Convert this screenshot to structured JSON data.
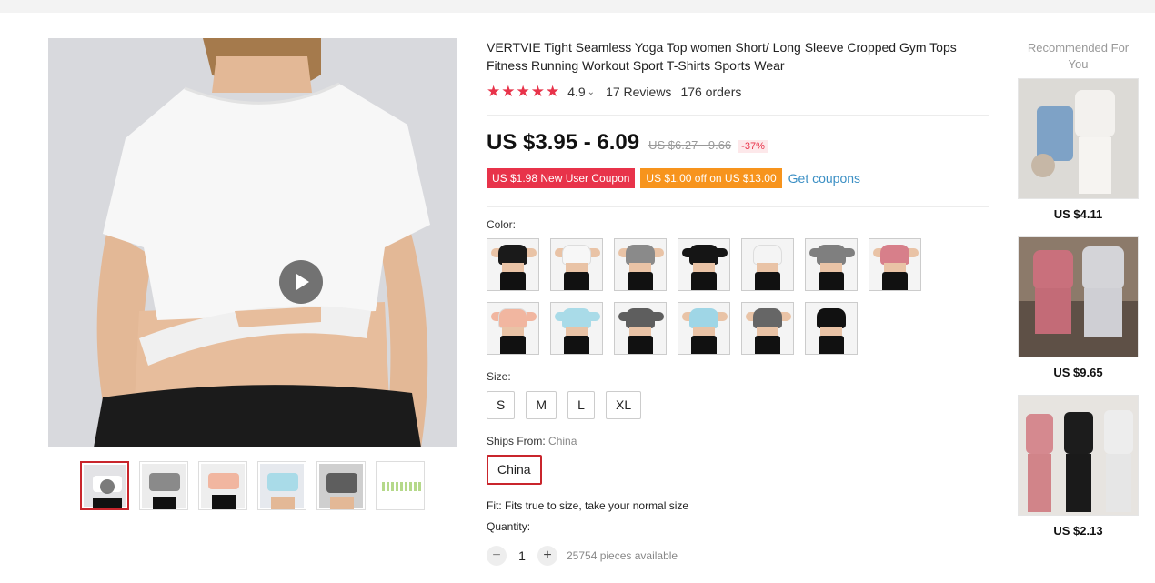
{
  "product": {
    "title": "VERTVIE Tight Seamless Yoga Top women Short/ Long Sleeve Cropped Gym Tops Fitness Running Workout Sport T-Shirts Sports Wear",
    "stars": "★★★★★",
    "rating": "4.9",
    "reviews": "17 Reviews",
    "orders": "176 orders",
    "price": "US $3.95 - 6.09",
    "old_price": "US $6.27 - 9.66",
    "discount": "-37%"
  },
  "coupons": {
    "new_user": "US $1.98 New User Coupon",
    "store": "US $1.00 off on US $13.00",
    "get_coupons": "Get coupons"
  },
  "color": {
    "label": "Color:",
    "swatches": [
      {
        "name": "black short sleeve",
        "color": "#1a1a1a"
      },
      {
        "name": "white short sleeve",
        "color": "#f7f7f7"
      },
      {
        "name": "grey short sleeve",
        "color": "#8a8a8a"
      },
      {
        "name": "black long sleeve",
        "color": "#151515"
      },
      {
        "name": "white long sleeve",
        "color": "#f4f4f4"
      },
      {
        "name": "grey long sleeve",
        "color": "#7f7f7f"
      },
      {
        "name": "pink short sleeve",
        "color": "#d77f8a"
      },
      {
        "name": "peach long sleeve",
        "color": "#f1b6a0"
      },
      {
        "name": "light blue long sleeve",
        "color": "#a9dbe8"
      },
      {
        "name": "dark grey long sleeve",
        "color": "#5e5e5e"
      },
      {
        "name": "light blue short sleeve",
        "color": "#9fd6e6"
      },
      {
        "name": "dark grey short sleeve",
        "color": "#666666"
      },
      {
        "name": "black tank",
        "color": "#111111"
      }
    ]
  },
  "size": {
    "label": "Size:",
    "options": [
      "S",
      "M",
      "L",
      "XL"
    ]
  },
  "ships_from": {
    "label": "Ships From:",
    "value_muted": "China",
    "option": "China"
  },
  "fit": "Fit: Fits true to size, take your normal size",
  "quantity": {
    "label": "Quantity:",
    "minus": "−",
    "value": "1",
    "plus": "+",
    "available": "25754 pieces available"
  },
  "recommended": {
    "title": "Recommended For You",
    "items": [
      {
        "price": "US $4.11"
      },
      {
        "price": "US $9.65"
      },
      {
        "price": "US $2.13"
      }
    ]
  },
  "gallery": {
    "thumb_colors": [
      "#f7f7f7",
      "#8a8a8a",
      "#f1b6a0",
      "#a9dbe8",
      "#5e5e5e",
      "#ffffff"
    ]
  }
}
